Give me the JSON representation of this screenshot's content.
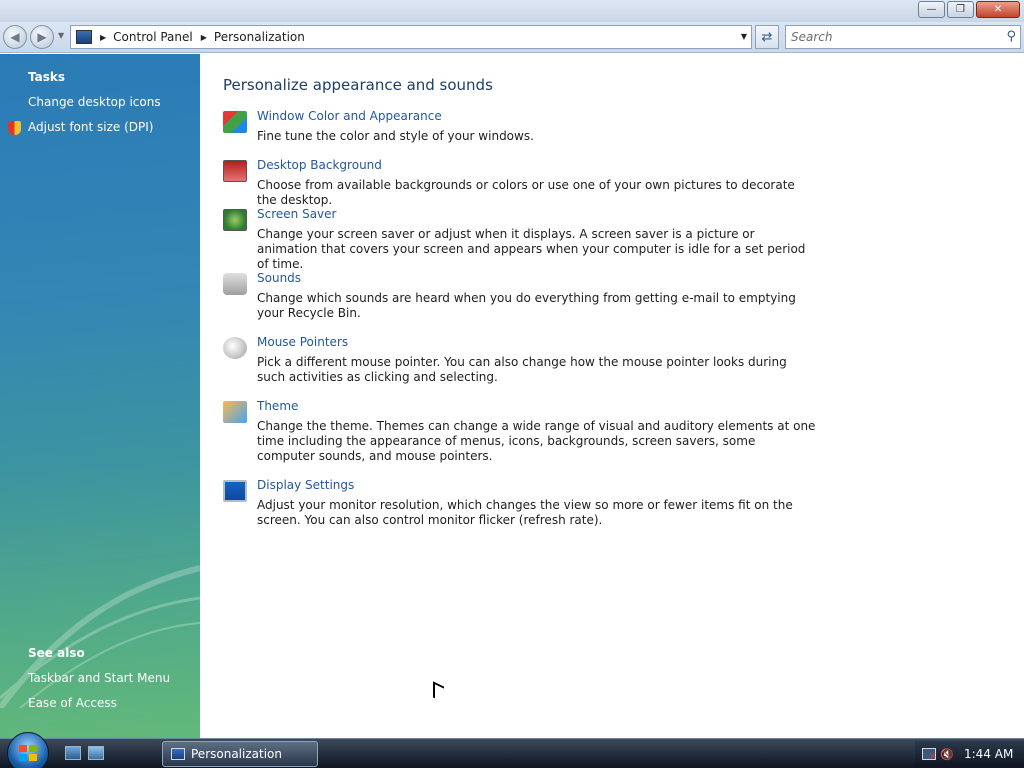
{
  "window": {
    "buttons": {
      "minimize": "—",
      "maximize": "❐",
      "close": "✕"
    }
  },
  "navbar": {
    "breadcrumbs": [
      "Control Panel",
      "Personalization"
    ],
    "search_placeholder": "Search"
  },
  "sidebar": {
    "tasks_heading": "Tasks",
    "tasks": [
      {
        "label": "Change desktop icons"
      },
      {
        "label": "Adjust font size (DPI)",
        "icon": "shield-icon"
      }
    ],
    "see_also_heading": "See also",
    "see_also": [
      {
        "label": "Taskbar and Start Menu"
      },
      {
        "label": "Ease of Access"
      }
    ]
  },
  "main": {
    "title": "Personalize appearance and sounds",
    "items": [
      {
        "label": "Window Color and Appearance",
        "description": "Fine tune the color and style of your windows.",
        "icon": "window-color-icon"
      },
      {
        "label": "Desktop Background",
        "description": "Choose from available backgrounds or colors or use one of your own pictures to decorate the desktop.",
        "icon": "desktop-background-icon"
      },
      {
        "label": "Screen Saver",
        "description": "Change your screen saver or adjust when it displays. A screen saver is a picture or animation that covers your screen and appears when your computer is idle for a set period of time.",
        "icon": "screen-saver-icon"
      },
      {
        "label": "Sounds",
        "description": "Change which sounds are heard when you do everything from getting e-mail to emptying your Recycle Bin.",
        "icon": "sounds-icon"
      },
      {
        "label": "Mouse Pointers",
        "description": "Pick a different mouse pointer. You can also change how the mouse pointer looks during such activities as clicking and selecting.",
        "icon": "mouse-pointers-icon"
      },
      {
        "label": "Theme",
        "description": "Change the theme. Themes can change a wide range of visual and auditory elements at one time including the appearance of menus, icons, backgrounds, screen savers, some computer sounds, and mouse pointers.",
        "icon": "theme-icon"
      },
      {
        "label": "Display Settings",
        "description": "Adjust your monitor resolution, which changes the view so more or fewer items fit on the screen. You can also control monitor flicker (refresh rate).",
        "icon": "display-settings-icon"
      }
    ]
  },
  "taskbar": {
    "active_window": "Personalization",
    "clock": "1:44 AM"
  }
}
